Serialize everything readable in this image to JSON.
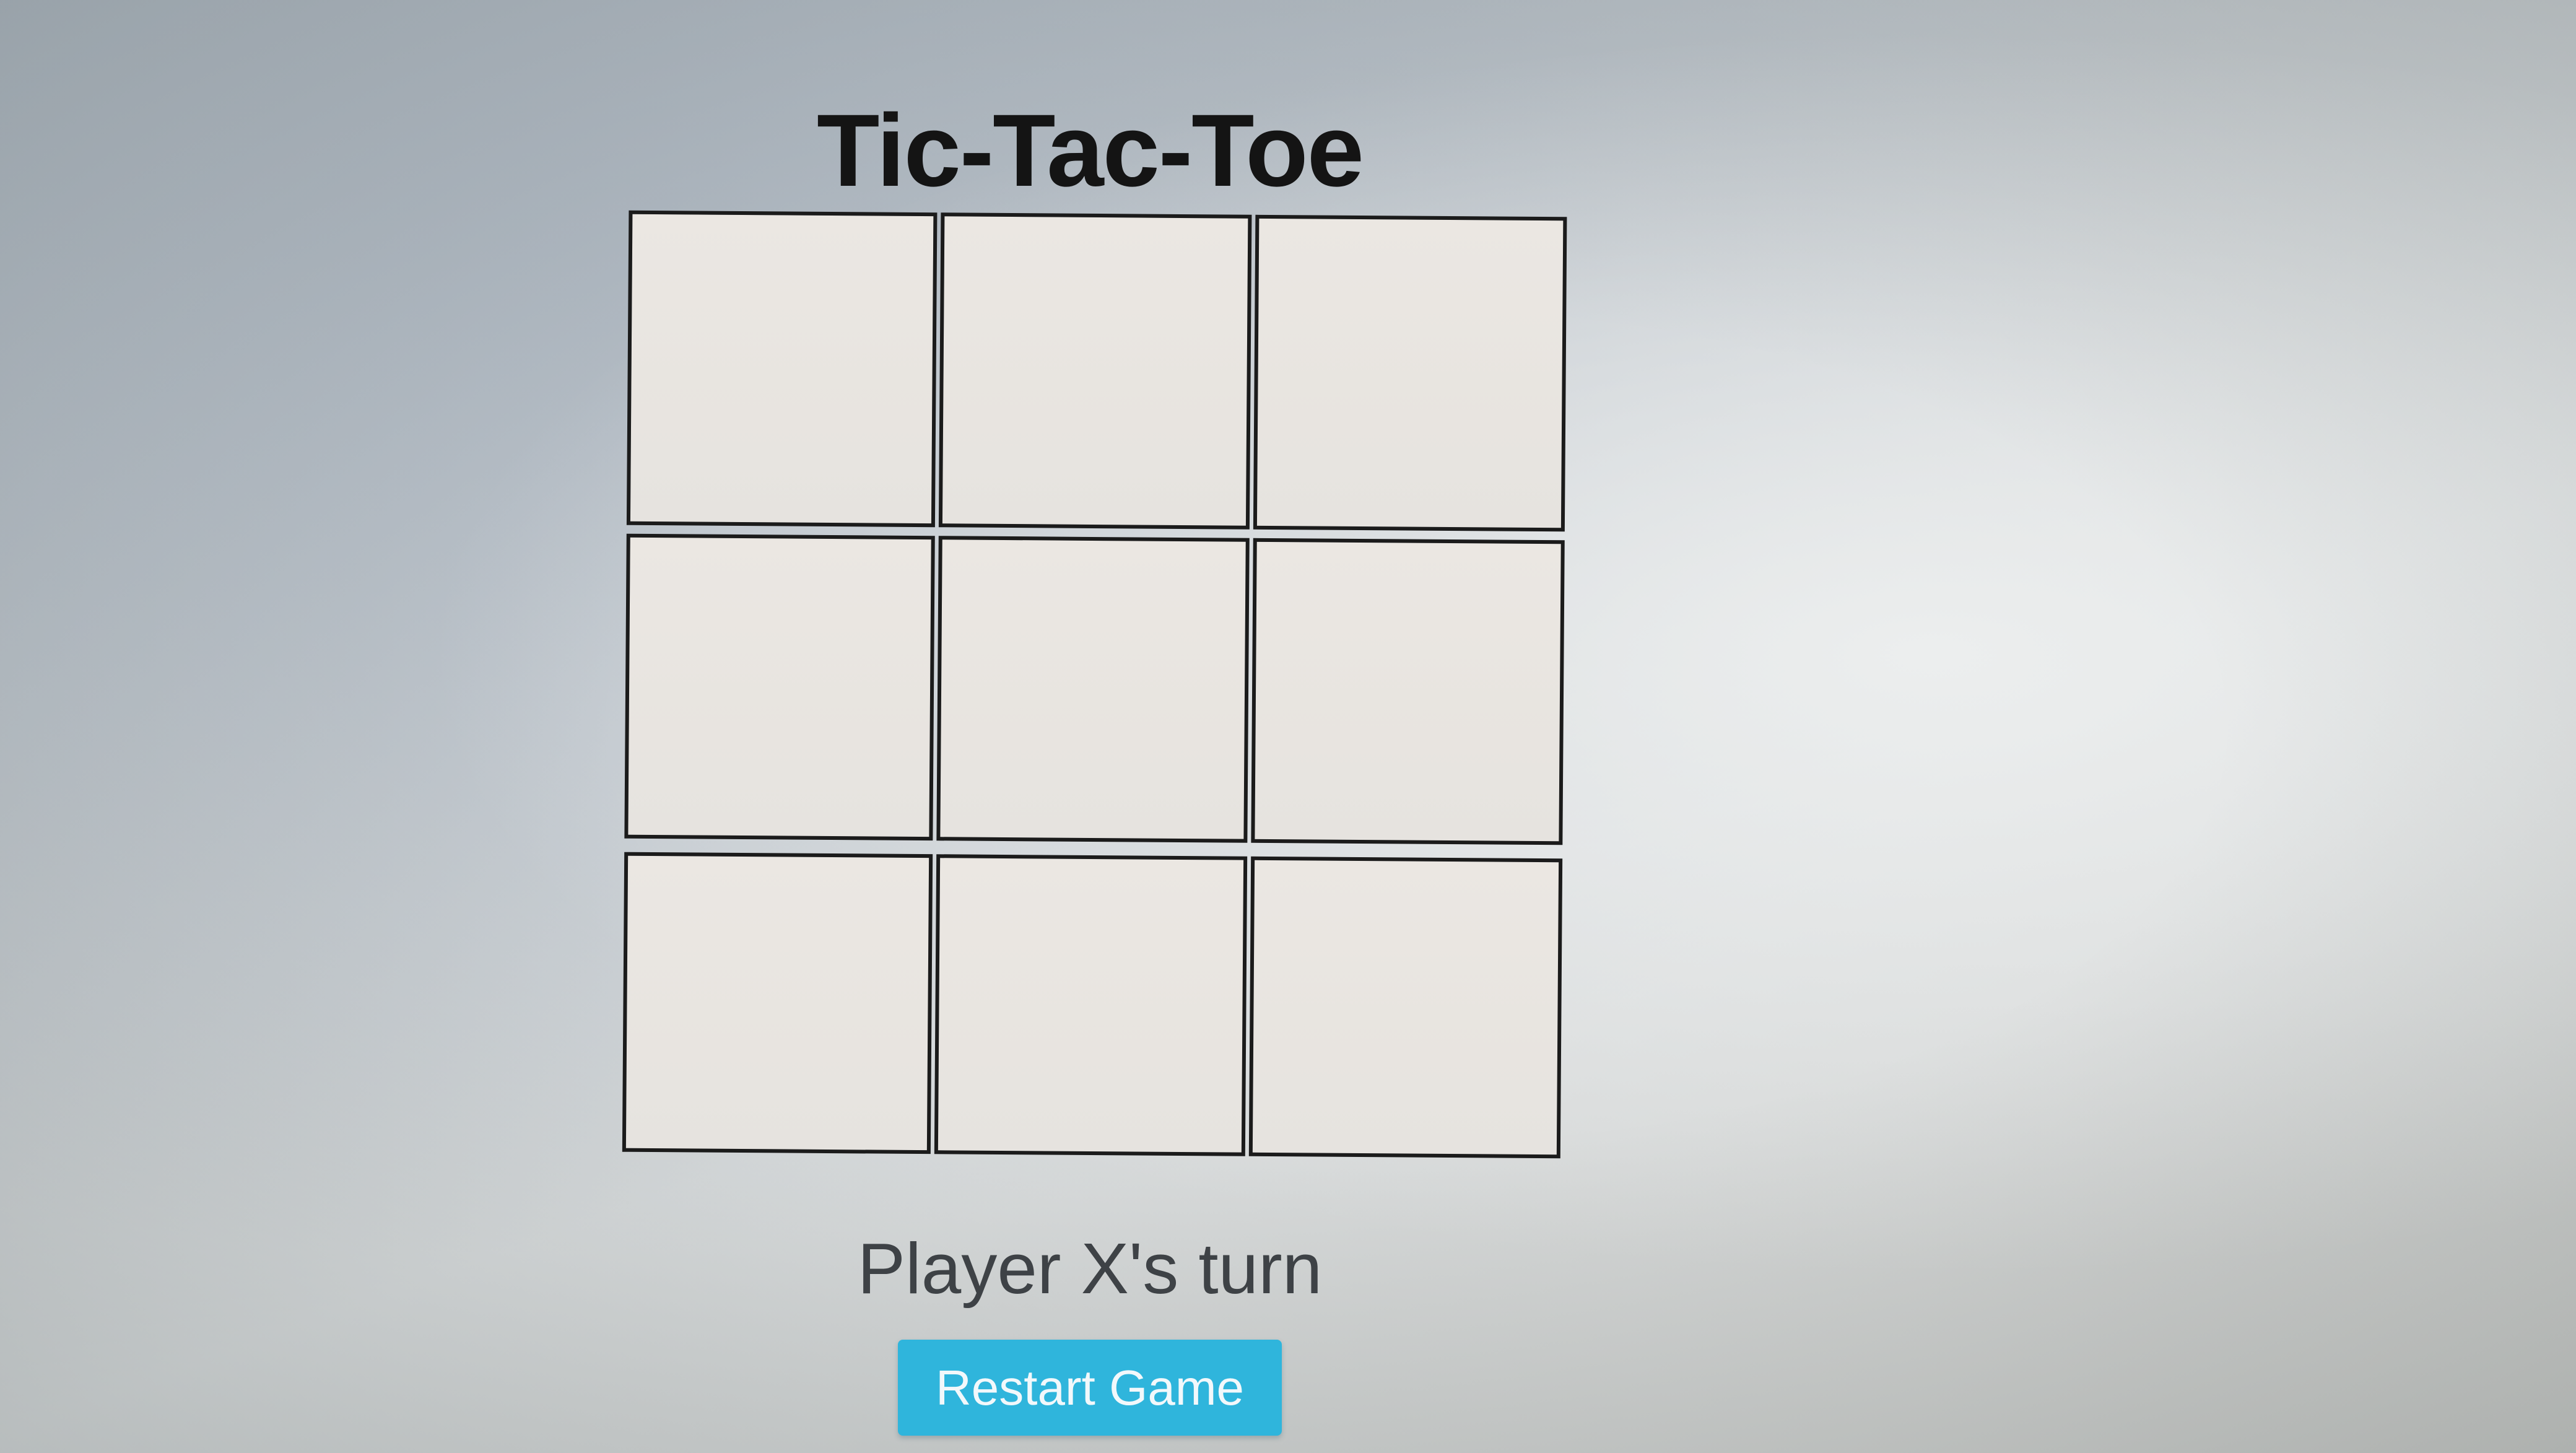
{
  "game": {
    "title": "Tic-Tac-Toe",
    "board": [
      [
        "",
        "",
        ""
      ],
      [
        "",
        "",
        ""
      ],
      [
        "",
        "",
        ""
      ]
    ],
    "status": "Player X's turn",
    "restart_label": "Restart Game"
  },
  "colors": {
    "button": "#2fb5dc",
    "cell_border": "#1b1b1b",
    "cell_fill": "#e9e6e1",
    "title": "#141414",
    "status": "#3e4246"
  }
}
